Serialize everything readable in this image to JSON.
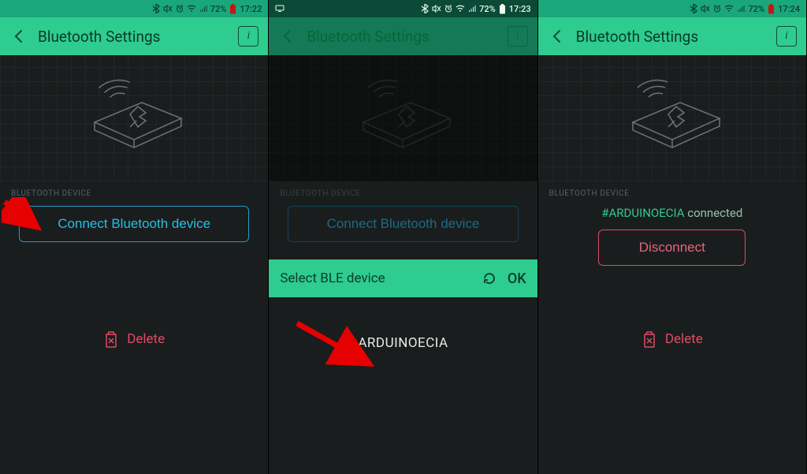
{
  "panels": [
    {
      "statusbar": {
        "battery": "72%",
        "time": "17:22",
        "battery_color": "#c01818"
      },
      "header": {
        "title": "Bluetooth Settings"
      },
      "section_label": "BLUETOOTH DEVICE",
      "connect_label": "Connect Bluetooth device",
      "delete_label": "Delete"
    },
    {
      "statusbar": {
        "battery": "72%",
        "time": "17:23",
        "battery_color": "#e9ffe9"
      },
      "header": {
        "title": "Bluetooth Settings"
      },
      "section_label": "BLUETOOTH DEVICE",
      "connect_label": "Connect Bluetooth device",
      "strip": {
        "label": "Select BLE device",
        "ok": "OK"
      },
      "device": "ARDUINOECIA"
    },
    {
      "statusbar": {
        "battery": "72%",
        "time": "17:24",
        "battery_color": "#c01818"
      },
      "header": {
        "title": "Bluetooth Settings"
      },
      "section_label": "BLUETOOTH DEVICE",
      "connected": {
        "tag": "#ARDUINOECIA",
        "suffix": " connected"
      },
      "disconnect_label": "Disconnect",
      "delete_label": "Delete"
    }
  ]
}
